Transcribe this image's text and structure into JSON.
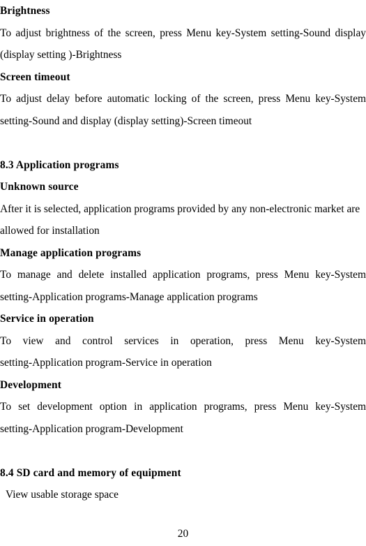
{
  "document": {
    "page_number": "20",
    "blocks": [
      {
        "kind": "heading",
        "name": "heading-brightness",
        "text": "Brightness"
      },
      {
        "kind": "paragraph",
        "name": "paragraph-brightness",
        "lines": [
          {
            "text": "To adjust brightness of the screen, press Menu key-System setting-Sound display",
            "justified": true
          },
          {
            "text": "(display setting )-Brightness",
            "justified": false
          }
        ]
      },
      {
        "kind": "heading",
        "name": "heading-screen-timeout",
        "text": "Screen timeout"
      },
      {
        "kind": "paragraph",
        "name": "paragraph-screen-timeout",
        "lines": [
          {
            "text": "To adjust delay before automatic locking of the screen, press Menu key-System",
            "justified": true
          },
          {
            "text": "setting-Sound and display (display setting)-Screen timeout",
            "justified": false
          }
        ]
      },
      {
        "kind": "blank",
        "name": "spacer-before-section-8-3"
      },
      {
        "kind": "heading",
        "name": "heading-section-8-3",
        "text": "8.3 Application programs"
      },
      {
        "kind": "heading",
        "name": "heading-unknown-source",
        "text": "Unknown source"
      },
      {
        "kind": "paragraph",
        "name": "paragraph-unknown-source",
        "lines": [
          {
            "text": "After it is selected, application programs provided by any non-electronic market are",
            "justified": false
          },
          {
            "text": "allowed for installation",
            "justified": false
          }
        ]
      },
      {
        "kind": "heading",
        "name": "heading-manage-application-programs",
        "text": "Manage application programs"
      },
      {
        "kind": "paragraph",
        "name": "paragraph-manage-application-programs",
        "lines": [
          {
            "text": "To manage and delete installed application programs, press Menu key-System",
            "justified": true
          },
          {
            "text": "setting-Application programs-Manage application programs",
            "justified": false
          }
        ]
      },
      {
        "kind": "heading",
        "name": "heading-service-in-operation",
        "text": "Service in operation"
      },
      {
        "kind": "paragraph",
        "name": "paragraph-service-in-operation",
        "lines": [
          {
            "text": "To view and control services in operation, press Menu key-System",
            "justified": true
          },
          {
            "text": "setting-Application program-Service in operation",
            "justified": false
          }
        ]
      },
      {
        "kind": "heading",
        "name": "heading-development",
        "text": "Development"
      },
      {
        "kind": "paragraph",
        "name": "paragraph-development",
        "lines": [
          {
            "text": "To set development option in application programs, press Menu key-System",
            "justified": true
          },
          {
            "text": "setting-Application program-Development",
            "justified": false
          }
        ]
      },
      {
        "kind": "blank",
        "name": "spacer-before-section-8-4"
      },
      {
        "kind": "heading",
        "name": "heading-section-8-4",
        "text": "8.4 SD card and memory of equipment"
      },
      {
        "kind": "paragraph-indented",
        "name": "paragraph-view-usable-storage-space",
        "lines": [
          {
            "text": "View usable storage space",
            "justified": false
          }
        ]
      }
    ]
  }
}
